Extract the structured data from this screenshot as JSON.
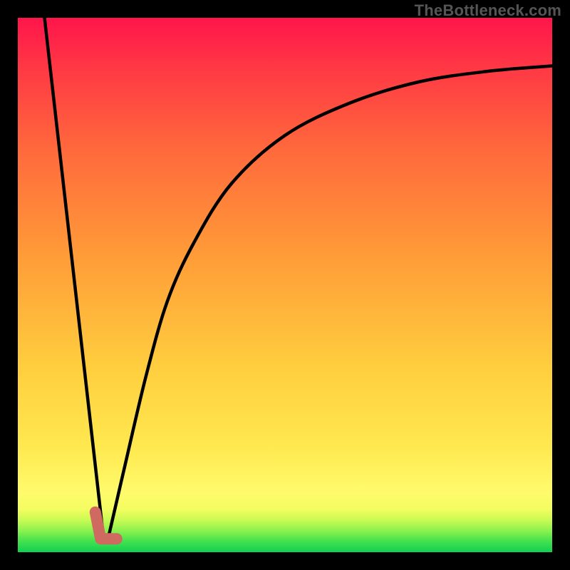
{
  "watermark": "TheBottleneck.com",
  "chart_data": {
    "type": "line",
    "title": "",
    "xlabel": "",
    "ylabel": "",
    "xlim": [
      0,
      100
    ],
    "ylim": [
      0,
      100
    ],
    "grid": false,
    "legend": false,
    "annotations": [],
    "gradient_bands": [
      {
        "y_start": 0,
        "y_end": 2,
        "color": "#11d050"
      },
      {
        "y_start": 2,
        "y_end": 4,
        "color": "#55e84f"
      },
      {
        "y_start": 4,
        "y_end": 6,
        "color": "#a6f64e"
      },
      {
        "y_start": 6,
        "y_end": 8,
        "color": "#e6fd5d"
      },
      {
        "y_start": 8,
        "y_end": 12,
        "color": "#fff96a"
      },
      {
        "y_start": 12,
        "y_end": 30,
        "color": "#ffe24e"
      },
      {
        "y_start": 30,
        "y_end": 55,
        "color": "#ffb53c"
      },
      {
        "y_start": 55,
        "y_end": 78,
        "color": "#ff7f3a"
      },
      {
        "y_start": 78,
        "y_end": 92,
        "color": "#ff4c42"
      },
      {
        "y_start": 92,
        "y_end": 100,
        "color": "#ff1a4a"
      }
    ],
    "series": [
      {
        "name": "left_line",
        "x": [
          5,
          16
        ],
        "y": [
          100,
          3
        ]
      },
      {
        "name": "right_curve",
        "x": [
          17,
          20,
          24,
          28,
          33,
          40,
          50,
          62,
          75,
          88,
          100
        ],
        "y": [
          3,
          16,
          33,
          47,
          58,
          69,
          78,
          84,
          88,
          90,
          91
        ]
      }
    ],
    "marker": {
      "name": "highlight",
      "color": "#cf6a60",
      "path_points": [
        {
          "x": 14.5,
          "y": 7.5
        },
        {
          "x": 15.5,
          "y": 2.5
        },
        {
          "x": 18.5,
          "y": 2.5
        }
      ]
    }
  }
}
